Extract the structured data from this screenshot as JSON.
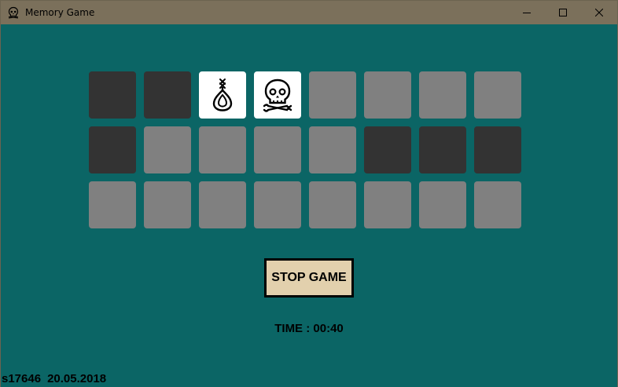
{
  "window": {
    "title": "Memory Game",
    "app_icon": "skull-icon",
    "controls": [
      "minimize-icon",
      "maximize-icon",
      "close-icon"
    ]
  },
  "colors": {
    "background": "#0b6565",
    "titlebar": "#7b705b",
    "card_hidden": "#808080",
    "card_matched": "#333333",
    "card_open": "#ffffff",
    "stop_button": "#e2d0ad"
  },
  "board": {
    "rows": 3,
    "cols": 8,
    "cards": [
      [
        "matched",
        "matched",
        "open:noose",
        "open:skull",
        "hidden",
        "hidden",
        "hidden",
        "hidden"
      ],
      [
        "matched",
        "hidden",
        "hidden",
        "hidden",
        "hidden",
        "matched",
        "matched",
        "matched"
      ],
      [
        "hidden",
        "hidden",
        "hidden",
        "hidden",
        "hidden",
        "hidden",
        "hidden",
        "hidden"
      ]
    ]
  },
  "controls": {
    "stop_label": "STOP GAME"
  },
  "status": {
    "time_text": "TIME : 00:40"
  },
  "footer": {
    "student_id": "s17646",
    "date": "20.05.2018"
  }
}
